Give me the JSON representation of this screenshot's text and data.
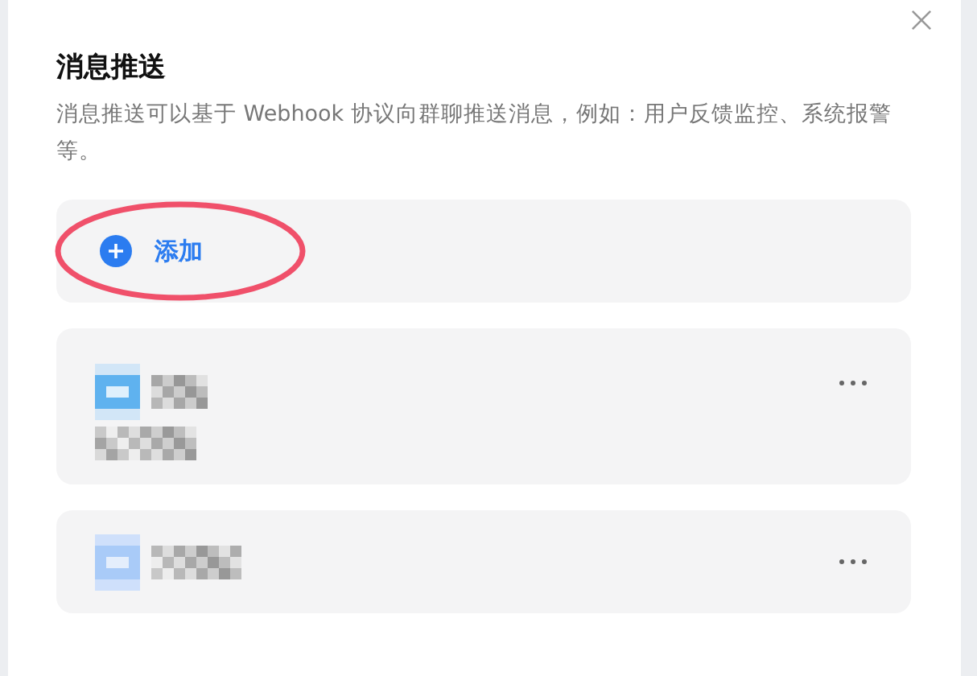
{
  "dialog": {
    "title": "消息推送",
    "description": "消息推送可以基于 Webhook 协议向群聊推送消息，例如：用户反馈监控、系统报警等。"
  },
  "add": {
    "label": "添加",
    "highlighted": true
  },
  "items": [
    {
      "kind": "detailed"
    },
    {
      "kind": "simple"
    }
  ]
}
